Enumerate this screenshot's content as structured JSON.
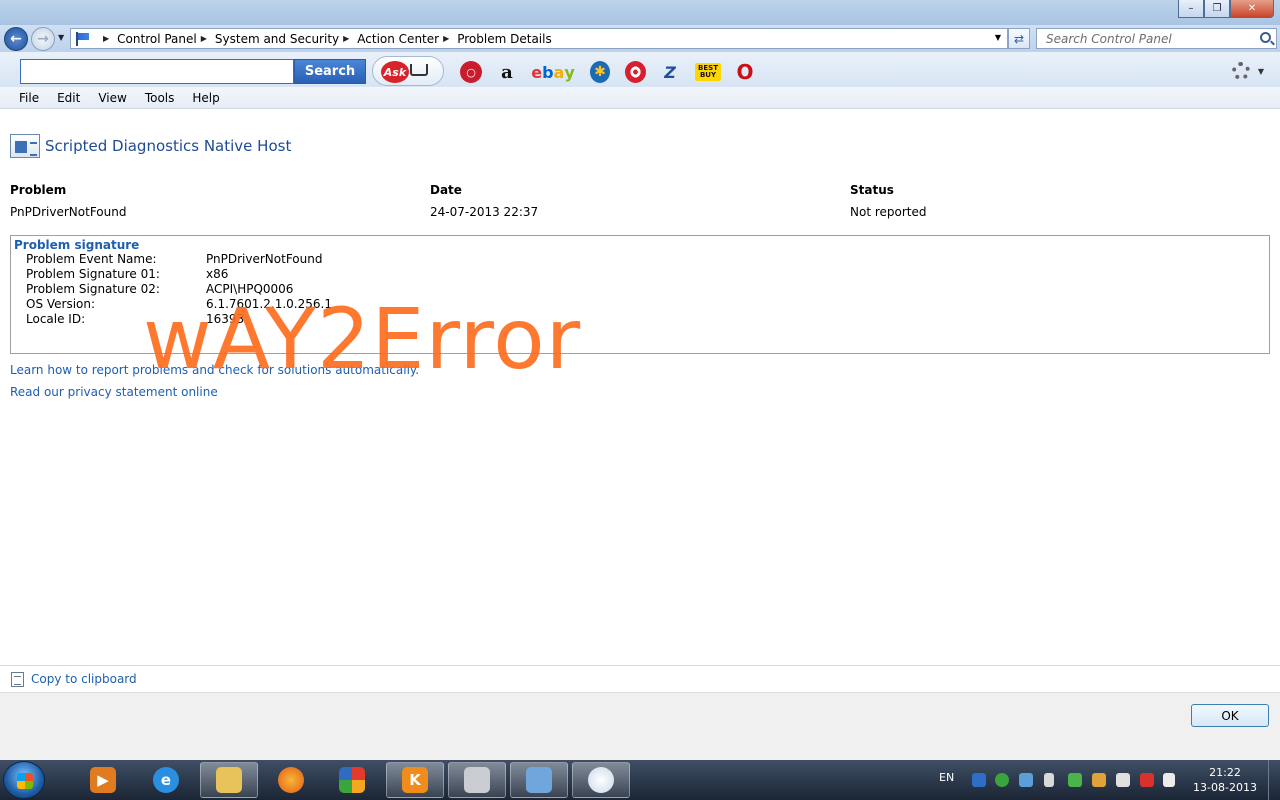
{
  "window": {
    "minimize_glyph": "–",
    "maximize_glyph": "❐",
    "close_glyph": "✕"
  },
  "address_bar": {
    "breadcrumbs": [
      "Control Panel",
      "System and Security",
      "Action Center",
      "Problem Details"
    ],
    "search_placeholder": "Search Control Panel"
  },
  "toolbar": {
    "search_button": "Search",
    "ask_label": "Ask",
    "bestbuy_label": "BEST BUY",
    "icons": [
      "ask-icon",
      "cart-icon",
      "red-circle-icon",
      "amazon-icon",
      "ebay-icon",
      "walmart-icon",
      "target-icon",
      "zappos-icon",
      "bestbuy-icon",
      "opera-icon",
      "gear-icon"
    ],
    "ebay_letters": [
      "e",
      "b",
      "a",
      "y"
    ],
    "amazon_glyph": "a",
    "zappos_glyph": "Z",
    "opera_glyph": "O"
  },
  "menubar": [
    "File",
    "Edit",
    "View",
    "Tools",
    "Help"
  ],
  "main": {
    "title": "Scripted Diagnostics Native Host",
    "columns": {
      "problem_header": "Problem",
      "date_header": "Date",
      "status_header": "Status",
      "problem_value": "PnPDriverNotFound",
      "date_value": "24-07-2013 22:37",
      "status_value": "Not reported"
    },
    "signature": {
      "title": "Problem signature",
      "rows": [
        {
          "label": "Problem Event Name:",
          "value": "PnPDriverNotFound"
        },
        {
          "label": "Problem Signature 01:",
          "value": "x86"
        },
        {
          "label": "Problem Signature 02:",
          "value": "ACPI\\HPQ0006"
        },
        {
          "label": "OS Version:",
          "value": "6.1.7601.2.1.0.256.1"
        },
        {
          "label": "Locale ID:",
          "value": "16393"
        }
      ]
    },
    "links": {
      "learn": "Learn how to report problems and check for solutions automatically.",
      "privacy": "Read our privacy statement online"
    },
    "watermark": "wAY2Error"
  },
  "footer": {
    "copy_link": "Copy to clipboard",
    "ok_button": "OK"
  },
  "taskbar": {
    "apps": [
      "media-player-icon",
      "internet-explorer-icon",
      "file-explorer-icon",
      "firefox-icon",
      "avg-icon",
      "kingsoft-icon",
      "scanner-icon",
      "control-panel-icon",
      "paint-icon"
    ],
    "active_app": "control-panel-icon",
    "language": "EN",
    "time": "21:22",
    "date": "13-08-2013"
  },
  "colors": {
    "link": "#1e5fb0",
    "title": "#1e4c94",
    "watermark": "#ff6a1a"
  }
}
